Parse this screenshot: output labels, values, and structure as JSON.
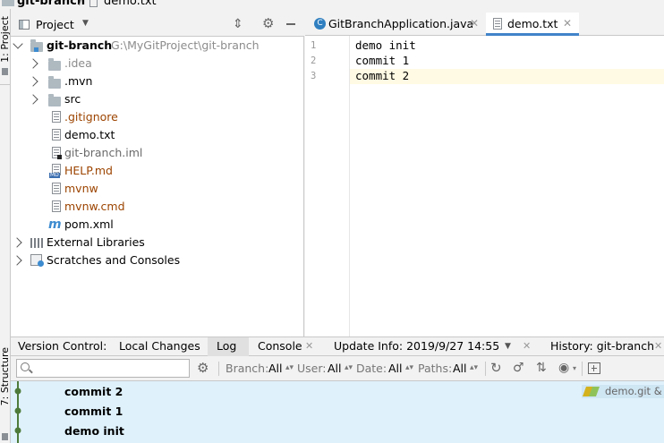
{
  "breadcrumb": {
    "project": "git-branch",
    "file": "demo.txt",
    "separator": "/"
  },
  "left_strip": {
    "project_tab": "1: Project",
    "structure_tab": "7: Structure"
  },
  "project_pane": {
    "title": "Project",
    "tree": [
      {
        "label": "git-branch",
        "path": "G:\\MyGitProject\\git-branch"
      },
      {
        "label": ".idea",
        "color": "#8b8b8b"
      },
      {
        "label": ".mvn"
      },
      {
        "label": "src"
      },
      {
        "label": ".gitignore",
        "color": "#9c4400"
      },
      {
        "label": "demo.txt"
      },
      {
        "label": "git-branch.iml",
        "color": "#6a6a6a"
      },
      {
        "label": "HELP.md",
        "color": "#9c4400"
      },
      {
        "label": "mvnw",
        "color": "#9c4400"
      },
      {
        "label": "mvnw.cmd",
        "color": "#9c4400"
      },
      {
        "label": "pom.xml"
      },
      {
        "label": "External Libraries"
      },
      {
        "label": "Scratches and Consoles"
      }
    ]
  },
  "editor": {
    "tabs": [
      {
        "label": "GitBranchApplication.java"
      },
      {
        "label": "demo.txt"
      }
    ],
    "lines": [
      {
        "num": "1",
        "text": "demo init"
      },
      {
        "num": "2",
        "text": "commit 1"
      },
      {
        "num": "3",
        "text": "commit 2"
      }
    ]
  },
  "bottom_panel": {
    "label": "Version Control:",
    "tabs": [
      {
        "label": "Local Changes"
      },
      {
        "label": "Log"
      },
      {
        "label": "Console"
      },
      {
        "label": "Update Info: 2019/9/27 14:55"
      },
      {
        "label": "History: git-branch"
      }
    ]
  },
  "log_toolbar": {
    "search_placeholder": "",
    "filters": [
      {
        "label": "Branch:",
        "value": "All"
      },
      {
        "label": "User:",
        "value": "All"
      },
      {
        "label": "Date:",
        "value": "All"
      },
      {
        "label": "Paths:",
        "value": "All"
      }
    ]
  },
  "commits": [
    {
      "message": "commit 2",
      "ref": "demo.git & r"
    },
    {
      "message": "commit 1"
    },
    {
      "message": "demo init"
    }
  ],
  "colors": {
    "accent_tab_underline": "#4083c9",
    "caret_line": "#fffae3",
    "commit_bg": "#dff2fc",
    "graph_node": "#4e7a3a",
    "vcs_orange": "#9c4400"
  }
}
